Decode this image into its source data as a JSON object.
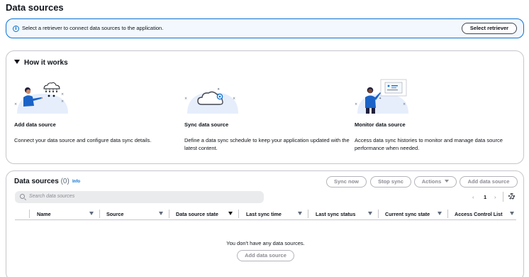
{
  "page": {
    "title": "Data sources"
  },
  "banner": {
    "text": "Select a retriever to connect data sources to the application.",
    "button_label": "Select retriever",
    "icon": "info-icon"
  },
  "how_it_works": {
    "title": "How it works",
    "steps": [
      {
        "title": "Add data source",
        "description": "Connect your data source and configure data sync details."
      },
      {
        "title": "Sync data source",
        "description": "Define a data sync schedule to keep your application updated with the latest content."
      },
      {
        "title": "Monitor data source",
        "description": "Access data sync histories to monitor and manage data source performance when needed."
      }
    ]
  },
  "data_sources": {
    "title": "Data sources",
    "count": "(0)",
    "info_link": "Info",
    "buttons": {
      "sync_now": "Sync now",
      "stop_sync": "Stop sync",
      "actions": "Actions",
      "add_data_source": "Add data source"
    },
    "search_placeholder": "Search data sources",
    "pagination": {
      "prev": "‹",
      "page": "1",
      "next": "›"
    },
    "columns": [
      "Name",
      "Source",
      "Data source state",
      "Last sync time",
      "Last sync status",
      "Current sync state",
      "Access Control List"
    ],
    "empty_text": "You don't have any data sources.",
    "empty_button": "Add data source"
  },
  "colors": {
    "accent": "#0972d3",
    "border": "#c6c6cd",
    "text": "#0f141a",
    "muted": "#8c8c94"
  }
}
